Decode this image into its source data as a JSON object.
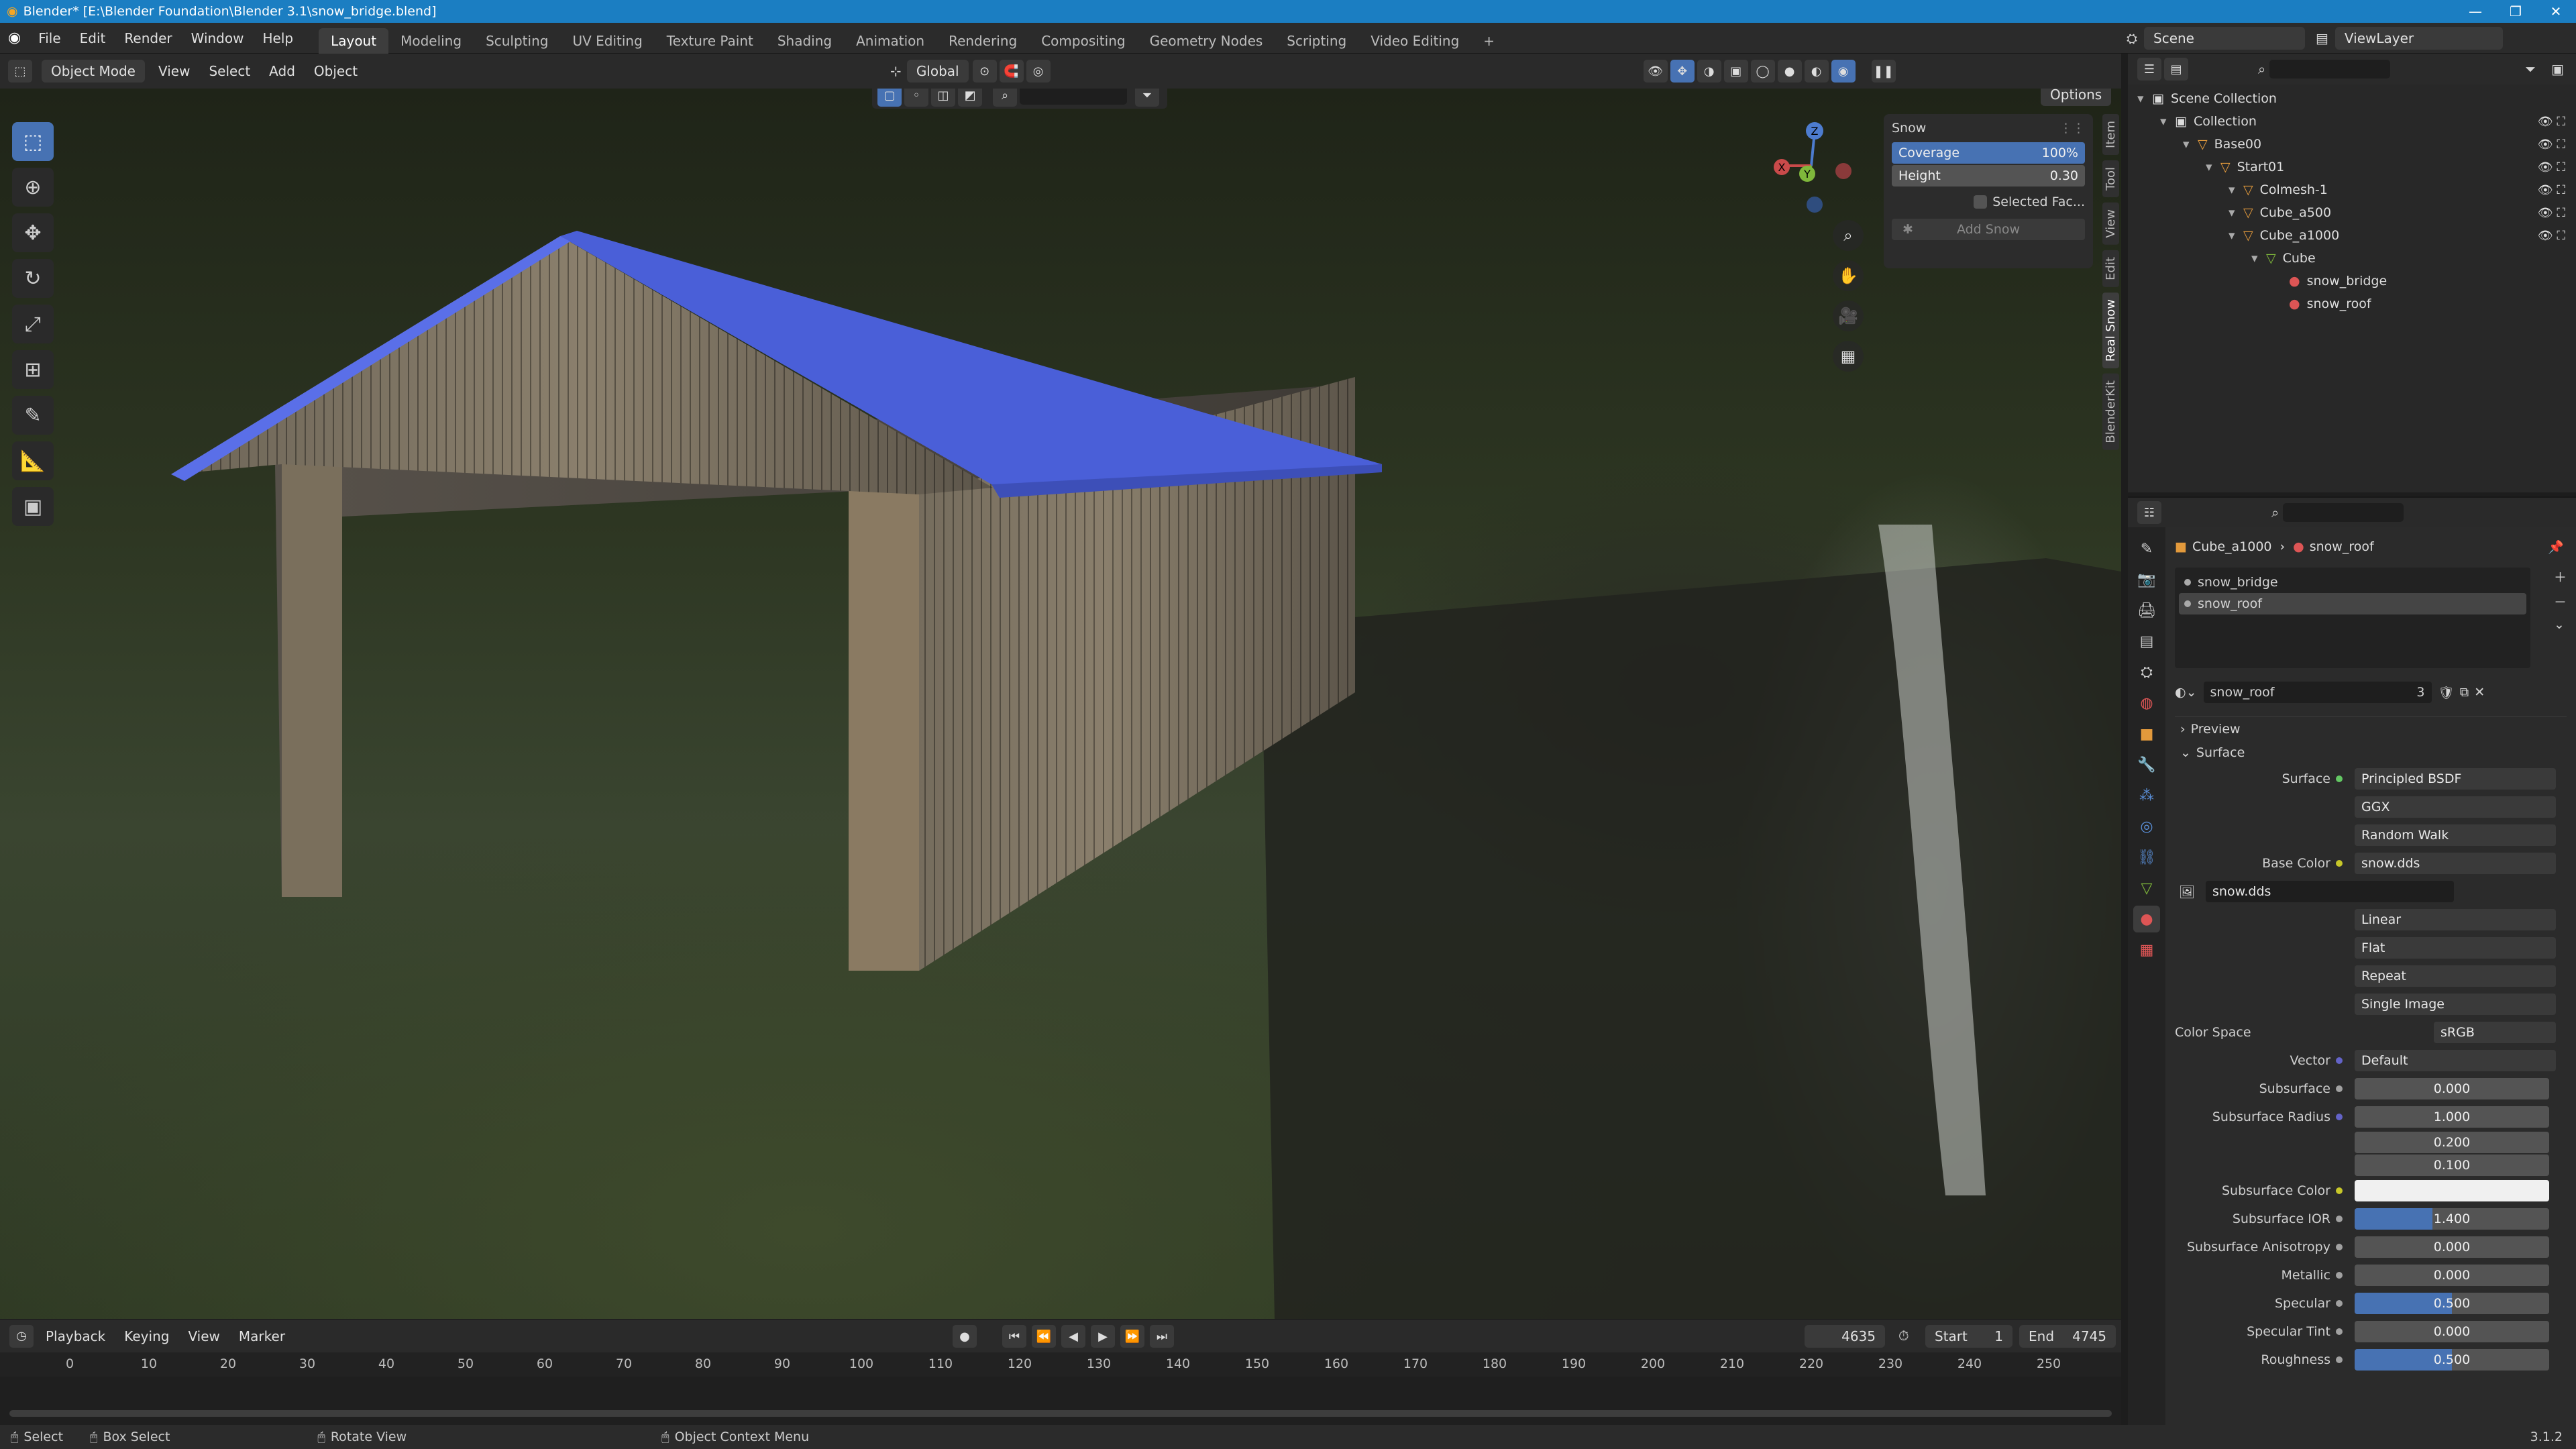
{
  "title": "Blender* [E:\\Blender Foundation\\Blender 3.1\\snow_bridge.blend]",
  "menus": [
    "File",
    "Edit",
    "Render",
    "Window",
    "Help"
  ],
  "workspaces": [
    "Layout",
    "Modeling",
    "Sculpting",
    "UV Editing",
    "Texture Paint",
    "Shading",
    "Animation",
    "Rendering",
    "Compositing",
    "Geometry Nodes",
    "Scripting",
    "Video Editing"
  ],
  "workspace_add": "+",
  "scene": "Scene",
  "viewlayer": "ViewLayer",
  "viewport": {
    "mode": "Object Mode",
    "menus": [
      "View",
      "Select",
      "Add",
      "Object"
    ],
    "orientation": "Global",
    "options_label": "Options",
    "side_tabs": [
      "Item",
      "Tool",
      "View",
      "Edit",
      "Real Snow",
      "BlenderKit"
    ],
    "gizmo": {
      "z": "Z",
      "y": "Y",
      "x": "X"
    }
  },
  "snow_panel": {
    "title": "Snow",
    "coverage_label": "Coverage",
    "coverage_value": "100%",
    "height_label": "Height",
    "height_value": "0.30",
    "selected_faces": "Selected Fac...",
    "add_snow": "Add Snow"
  },
  "timeline": {
    "menus": [
      "Playback",
      "Keying",
      "View",
      "Marker"
    ],
    "current_frame": "4635",
    "start_label": "Start",
    "start": "1",
    "end_label": "End",
    "end": "4745",
    "ticks": [
      "0",
      "10",
      "20",
      "30",
      "40",
      "50",
      "60",
      "70",
      "80",
      "90",
      "100",
      "110",
      "120",
      "130",
      "140",
      "150",
      "160",
      "170",
      "180",
      "190",
      "200",
      "210",
      "220",
      "230",
      "240",
      "250"
    ]
  },
  "status": {
    "select": "Select",
    "box_select": "Box Select",
    "rotate_view": "Rotate View",
    "context_menu": "Object Context Menu",
    "version": "3.1.2"
  },
  "outliner": {
    "rows": [
      {
        "label": "Scene Collection",
        "indent": 0,
        "icon": "scene-collection-icon"
      },
      {
        "label": "Collection",
        "indent": 1,
        "icon": "collection-icon"
      },
      {
        "label": "Base00",
        "indent": 2,
        "icon": "object-icon"
      },
      {
        "label": "Start01",
        "indent": 3,
        "icon": "object-icon"
      },
      {
        "label": "Colmesh-1",
        "indent": 4,
        "icon": "object-icon"
      },
      {
        "label": "Cube_a500",
        "indent": 4,
        "icon": "object-icon"
      },
      {
        "label": "Cube_a1000",
        "indent": 4,
        "icon": "object-icon"
      },
      {
        "label": "Cube",
        "indent": 5,
        "icon": "mesh-icon"
      },
      {
        "label": "snow_bridge",
        "indent": 6,
        "icon": "material-icon"
      },
      {
        "label": "snow_roof",
        "indent": 6,
        "icon": "material-icon"
      }
    ]
  },
  "properties": {
    "breadcrumb_object": "Cube_a1000",
    "breadcrumb_material": "snow_roof",
    "slots": [
      "snow_bridge",
      "snow_roof"
    ],
    "material_name": "snow_roof",
    "users": "3",
    "preview_label": "Preview",
    "surface_section": "Surface",
    "surface_label": "Surface",
    "surface_value": "Principled BSDF",
    "distribution": "GGX",
    "subsurface_method": "Random Walk",
    "base_color_label": "Base Color",
    "base_color_value": "snow.dds",
    "image_name": "snow.dds",
    "interpolation": "Linear",
    "projection": "Flat",
    "extension": "Repeat",
    "source": "Single Image",
    "color_space_label": "Color Space",
    "color_space": "sRGB",
    "vector_label": "Vector",
    "vector_value": "Default",
    "subsurface_label": "Subsurface",
    "subsurface": "0.000",
    "subsurface_radius_label": "Subsurface Radius",
    "radius_r": "1.000",
    "radius_g": "0.200",
    "radius_b": "0.100",
    "subsurface_color_label": "Subsurface Color",
    "subsurface_ior_label": "Subsurface IOR",
    "subsurface_ior": "1.400",
    "subsurface_ior_fill": 0.4,
    "anisotropy_label": "Subsurface Anisotropy",
    "anisotropy": "0.000",
    "metallic_label": "Metallic",
    "metallic": "0.000",
    "specular_label": "Specular",
    "specular": "0.500",
    "specular_fill": 0.5,
    "specular_tint_label": "Specular Tint",
    "specular_tint": "0.000",
    "roughness_label": "Roughness",
    "roughness": "0.500",
    "roughness_fill": 0.5
  },
  "colors": {
    "accent": "#4772b3",
    "title_bar": "#1b7ec2",
    "roof": "#4a5fd8"
  }
}
